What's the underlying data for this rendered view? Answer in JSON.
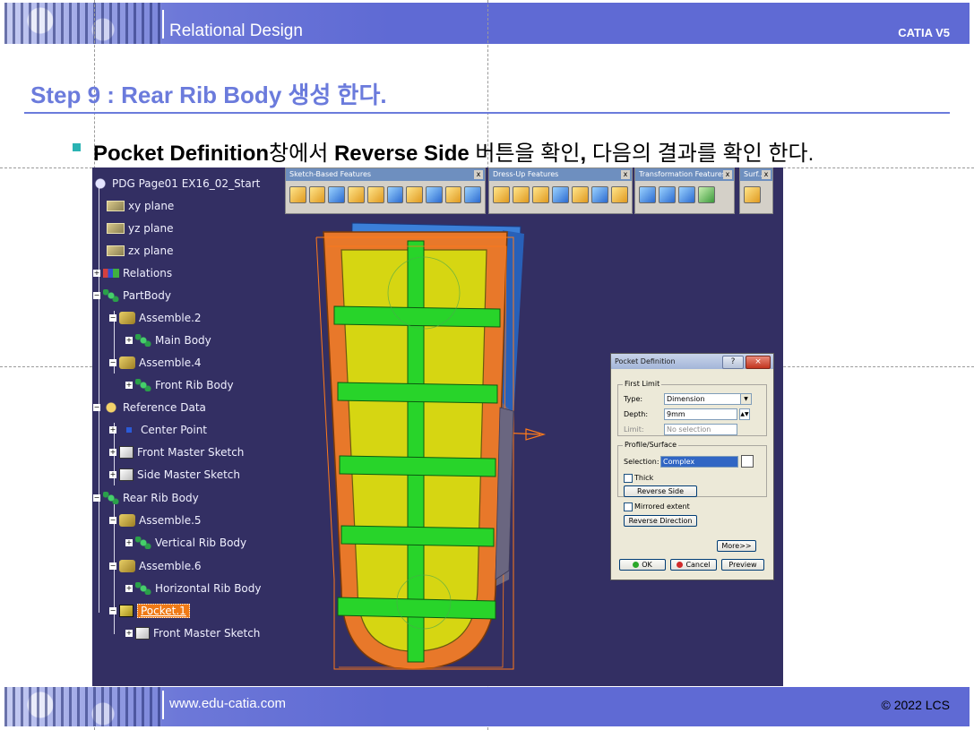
{
  "header": {
    "title": "Relational Design",
    "product": "CATIA V5"
  },
  "footer": {
    "website": "www.edu-catia.com",
    "copyright": "© 2022 LCS"
  },
  "step": {
    "title": "Step 9 : Rear Rib Body 생성 한다.",
    "instruction_parts": {
      "p1": "Pocket Definition",
      "p2": "창에서 ",
      "p3": "Reverse Side",
      "p4": " 버튼을 확인",
      "p5": ", ",
      "p6": "다음의 결과를 확인 한다."
    }
  },
  "tree": {
    "root": "PDG Page01 EX16_02_Start",
    "xy_plane": "xy plane",
    "yz_plane": "yz plane",
    "zx_plane": "zx plane",
    "relations": "Relations",
    "partbody": "PartBody",
    "assemble2": "Assemble.2",
    "main_body": "Main Body",
    "assemble4": "Assemble.4",
    "front_rib_body": "Front Rib Body",
    "reference_data": "Reference Data",
    "center_point": "Center Point",
    "front_master_sketch": "Front Master Sketch",
    "side_master_sketch": "Side Master Sketch",
    "rear_rib_body": "Rear Rib Body",
    "assemble5": "Assemble.5",
    "vertical_rib_body": "Vertical Rib Body",
    "assemble6": "Assemble.6",
    "horizontal_rib_body": "Horizontal Rib Body",
    "pocket1": "Pocket.1",
    "pocket_sketch": "Front Master Sketch"
  },
  "toolbars": {
    "sketch_based": "Sketch-Based Features",
    "dress_up": "Dress-Up Features",
    "transformation": "Transformation Features",
    "surface": "Surf..."
  },
  "dialog": {
    "title": "Pocket Definition",
    "help": "?",
    "close": "×",
    "first_limit": "First Limit",
    "type_label": "Type:",
    "type_value": "Dimension",
    "depth_label": "Depth:",
    "depth_value": "9mm",
    "limit_label": "Limit:",
    "limit_value": "No selection",
    "profile_surface": "Profile/Surface",
    "selection_label": "Selection:",
    "selection_value": "Complex",
    "thick": "Thick",
    "reverse_side": "Reverse Side",
    "mirrored_extent": "Mirrored extent",
    "reverse_direction": "Reverse Direction",
    "more": "More>>",
    "ok": "OK",
    "cancel": "Cancel",
    "preview": "Preview"
  },
  "colors": {
    "accent_blue": "#6b7bdc",
    "viewport_bg": "#332f63",
    "frame_orange": "#e8782a",
    "panel_yellow": "#d6d612",
    "rib_green": "#28d42a",
    "back_blue": "#3b7fd8"
  }
}
